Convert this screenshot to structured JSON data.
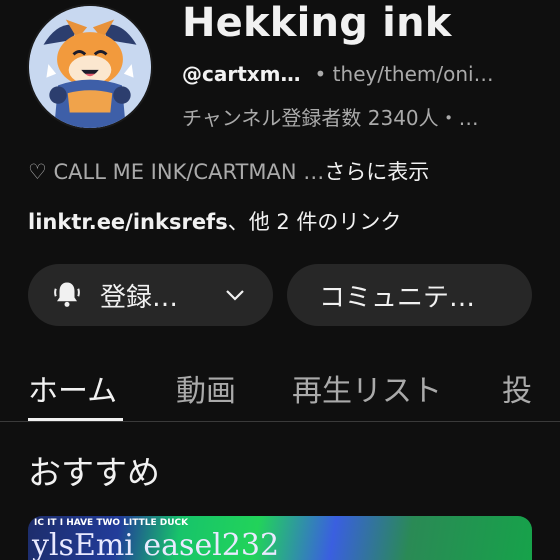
{
  "channel": {
    "title": "Hekking ink",
    "handle": "@cartxm…",
    "pronouns": "• they/them/oni…",
    "subscribers": "チャンネル登録者数 2340人・…",
    "bio_text": "♡ CALL ME INK/CARTMAN …",
    "bio_more": "さらに表示",
    "link_url": "linktr.ee/inksrefs",
    "link_rest": "、他 2 件のリンク"
  },
  "buttons": {
    "subscribe_label": "登録…",
    "community_label": "コミュニテ…"
  },
  "tabs": [
    {
      "label": "ホーム",
      "active": true
    },
    {
      "label": "動画",
      "active": false
    },
    {
      "label": "再生リスト",
      "active": false
    },
    {
      "label": "投",
      "active": false
    }
  ],
  "section": {
    "title": "おすすめ"
  },
  "video": {
    "thumb_top_text": "IC IT I HAVE TWO LITTLE DUCK",
    "thumb_text": "ylsEmi  easel232"
  },
  "colors": {
    "background": "#0f0f0f",
    "button_bg": "#272727",
    "text_primary": "#f1f1f1",
    "text_secondary": "#aaaaaa"
  },
  "icons": {
    "bell": "bell-icon",
    "chevron": "chevron-down-icon"
  }
}
